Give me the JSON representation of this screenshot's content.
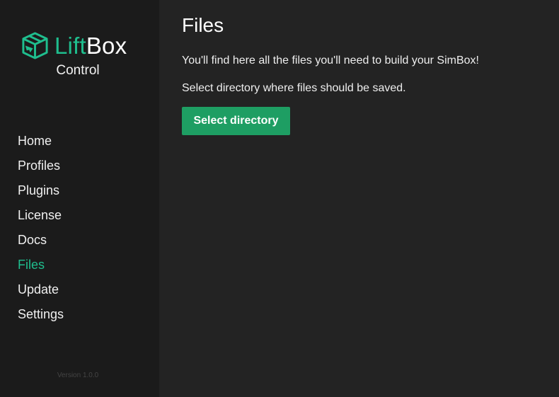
{
  "brand": {
    "name_part1": "Lift",
    "name_part2": "Box",
    "subtitle": "Control",
    "logo_icon": "package-plane-icon",
    "accent_color": "#1fbe8e"
  },
  "nav": {
    "items": [
      {
        "label": "Home",
        "active": false
      },
      {
        "label": "Profiles",
        "active": false
      },
      {
        "label": "Plugins",
        "active": false
      },
      {
        "label": "License",
        "active": false
      },
      {
        "label": "Docs",
        "active": false
      },
      {
        "label": "Files",
        "active": true
      },
      {
        "label": "Update",
        "active": false
      },
      {
        "label": "Settings",
        "active": false
      }
    ]
  },
  "version": "Version 1.0.0",
  "main": {
    "title": "Files",
    "intro": "You'll find here all the files you'll need to build your SimBox!",
    "hint": "Select directory where files should be saved.",
    "select_button": "Select directory",
    "button_color": "#1e9e63"
  }
}
